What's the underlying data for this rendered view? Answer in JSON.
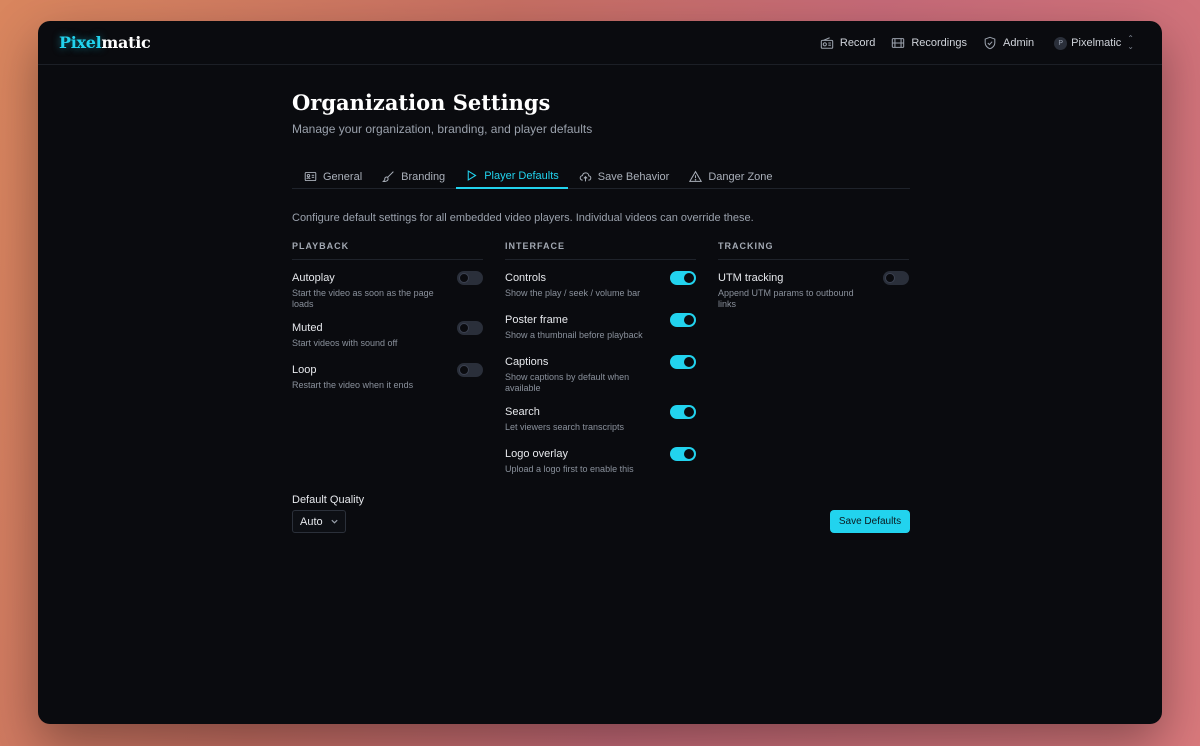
{
  "app": {
    "logo_part1": "Pixel",
    "logo_part2": "matic"
  },
  "nav": {
    "items": [
      {
        "label": "Record",
        "icon": "radio-icon"
      },
      {
        "label": "Recordings",
        "icon": "film-icon"
      },
      {
        "label": "Admin",
        "icon": "shield-icon"
      }
    ],
    "user": {
      "initial": "P",
      "name": "Pixelmatic"
    }
  },
  "page": {
    "title": "Organization Settings",
    "subtitle": "Manage your organization, branding, and player defaults",
    "description": "Configure default settings for all embedded video players. Individual videos can override these."
  },
  "tabs": [
    {
      "label": "General",
      "icon": "id-card-icon",
      "active": false
    },
    {
      "label": "Branding",
      "icon": "brush-icon",
      "active": false
    },
    {
      "label": "Player Defaults",
      "icon": "play-icon",
      "active": true
    },
    {
      "label": "Save Behavior",
      "icon": "cloud-upload-icon",
      "active": false
    },
    {
      "label": "Danger Zone",
      "icon": "warning-icon",
      "active": false
    }
  ],
  "sections": {
    "playback": {
      "heading": "PLAYBACK",
      "items": [
        {
          "title": "Autoplay",
          "desc": "Start the video as soon as the page loads",
          "on": false
        },
        {
          "title": "Muted",
          "desc": "Start videos with sound off",
          "on": false
        },
        {
          "title": "Loop",
          "desc": "Restart the video when it ends",
          "on": false
        }
      ]
    },
    "interface": {
      "heading": "INTERFACE",
      "items": [
        {
          "title": "Controls",
          "desc": "Show the play / seek / volume bar",
          "on": true
        },
        {
          "title": "Poster frame",
          "desc": "Show a thumbnail before playback",
          "on": true
        },
        {
          "title": "Captions",
          "desc": "Show captions by default when available",
          "on": true
        },
        {
          "title": "Search",
          "desc": "Let viewers search transcripts",
          "on": true
        },
        {
          "title": "Logo overlay",
          "desc": "Upload a logo first to enable this",
          "on": true
        }
      ]
    },
    "tracking": {
      "heading": "TRACKING",
      "items": [
        {
          "title": "UTM tracking",
          "desc": "Append UTM params to outbound links",
          "on": false
        }
      ]
    }
  },
  "quality": {
    "label": "Default Quality",
    "value": "Auto"
  },
  "save_button": "Save Defaults",
  "colors": {
    "accent": "#22d3ee",
    "background": "#0a0b0f"
  }
}
